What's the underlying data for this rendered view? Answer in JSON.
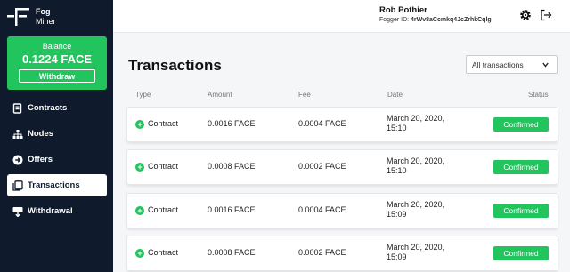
{
  "brand": {
    "line1": "Fog",
    "line2": "Miner"
  },
  "balance": {
    "label": "Balance",
    "value": "0.1224 FACE",
    "withdraw_label": "Withdraw"
  },
  "nav": [
    {
      "label": "Contracts",
      "icon": "contracts-icon"
    },
    {
      "label": "Nodes",
      "icon": "nodes-icon"
    },
    {
      "label": "Offers",
      "icon": "offers-icon"
    },
    {
      "label": "Transactions",
      "icon": "transactions-icon",
      "active": true
    },
    {
      "label": "Withdrawal",
      "icon": "withdrawal-icon"
    }
  ],
  "user": {
    "name": "Rob Pothier",
    "id_label": "Fogger ID:",
    "id_value": "4rWv8aCcmkq4JcZrhkCqlg"
  },
  "page": {
    "title": "Transactions",
    "filter_value": "All transactions"
  },
  "table": {
    "headers": {
      "type": "Type",
      "amount": "Amount",
      "fee": "Fee",
      "date": "Date",
      "status": "Status"
    },
    "rows": [
      {
        "type": "Contract",
        "amount": "0.0016 FACE",
        "fee": "0.0004 FACE",
        "date_line1": "March 20, 2020,",
        "date_line2": "15:10",
        "status": "Confirmed"
      },
      {
        "type": "Contract",
        "amount": "0.0008 FACE",
        "fee": "0.0002 FACE",
        "date_line1": "March 20, 2020,",
        "date_line2": "15:10",
        "status": "Confirmed"
      },
      {
        "type": "Contract",
        "amount": "0.0016 FACE",
        "fee": "0.0004 FACE",
        "date_line1": "March 20, 2020,",
        "date_line2": "15:09",
        "status": "Confirmed"
      },
      {
        "type": "Contract",
        "amount": "0.0008 FACE",
        "fee": "0.0002 FACE",
        "date_line1": "March 20, 2020,",
        "date_line2": "15:09",
        "status": "Confirmed"
      }
    ]
  },
  "colors": {
    "sidebar": "#0f1b2d",
    "accent_green": "#21c45d"
  }
}
